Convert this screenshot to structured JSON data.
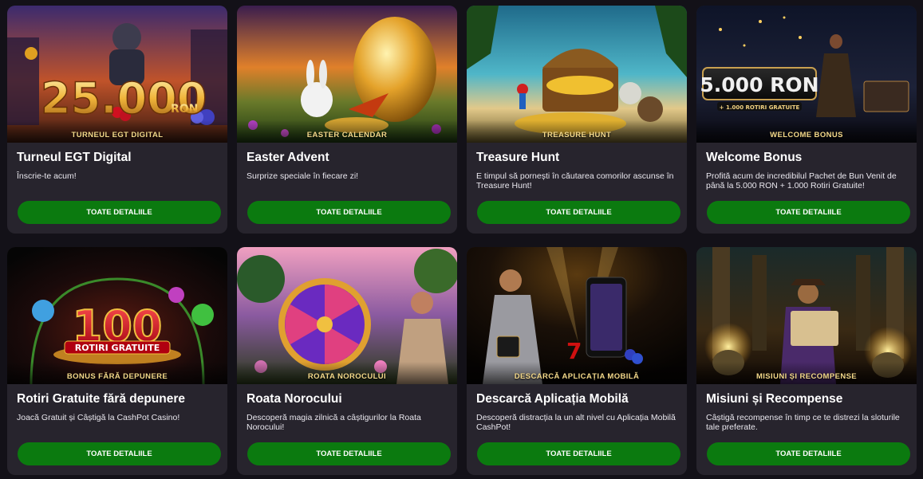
{
  "cards": [
    {
      "banner_caption": "TURNEUL EGT DIGITAL",
      "banner_text": "25.000",
      "banner_subtext": "RON",
      "title": "Turneul EGT Digital",
      "description": "Înscrie-te acum!",
      "button_label": "TOATE DETALIILE"
    },
    {
      "banner_caption": "EASTER CALENDAR",
      "title": "Easter Advent",
      "description": "Surprize speciale în fiecare zi!",
      "button_label": "TOATE DETALIILE"
    },
    {
      "banner_caption": "TREASURE HUNT",
      "title": "Treasure Hunt",
      "description": "E timpul să pornești în căutarea comorilor ascunse în Treasure Hunt!",
      "button_label": "TOATE DETALIILE"
    },
    {
      "banner_caption": "WELCOME BONUS",
      "banner_text": "5.000 RON",
      "banner_subtext": "+ 1.000 ROTIRI GRATUITE",
      "title": "Welcome Bonus",
      "description": "Profită acum de incredibilul Pachet de Bun Venit de până la 5.000 RON + 1.000 Rotiri Gratuite!",
      "button_label": "TOATE DETALIILE"
    },
    {
      "banner_caption": "BONUS FĂRĂ DEPUNERE",
      "banner_text": "100",
      "banner_subtext": "ROTIRI GRATUITE",
      "title": "Rotiri Gratuite fără depunere",
      "description": "Joacă Gratuit și Câștigă la CashPot Casino!",
      "button_label": "TOATE DETALIILE"
    },
    {
      "banner_caption": "ROATA NOROCULUI",
      "title": "Roata Norocului",
      "description": "Descoperă magia zilnică a câștigurilor la Roata Norocului!",
      "button_label": "TOATE DETALIILE"
    },
    {
      "banner_caption": "DESCARCĂ APLICAȚIA MOBILĂ",
      "title": "Descarcă Aplicația Mobilă",
      "description": "Descoperă distracția la un alt nivel cu Aplicația Mobilă CashPot!",
      "button_label": "TOATE DETALIILE"
    },
    {
      "banner_caption": "MISIUNI ȘI RECOMPENSE",
      "title": "Misiuni și Recompense",
      "description": "Câștigă recompense în timp ce te distrezi la sloturile tale preferate.",
      "button_label": "TOATE DETALIILE"
    }
  ],
  "colors": {
    "page_background": "#131118",
    "card_background": "#27242d",
    "button_green": "#0b7a0f",
    "caption_gold": "#f4d98a"
  }
}
